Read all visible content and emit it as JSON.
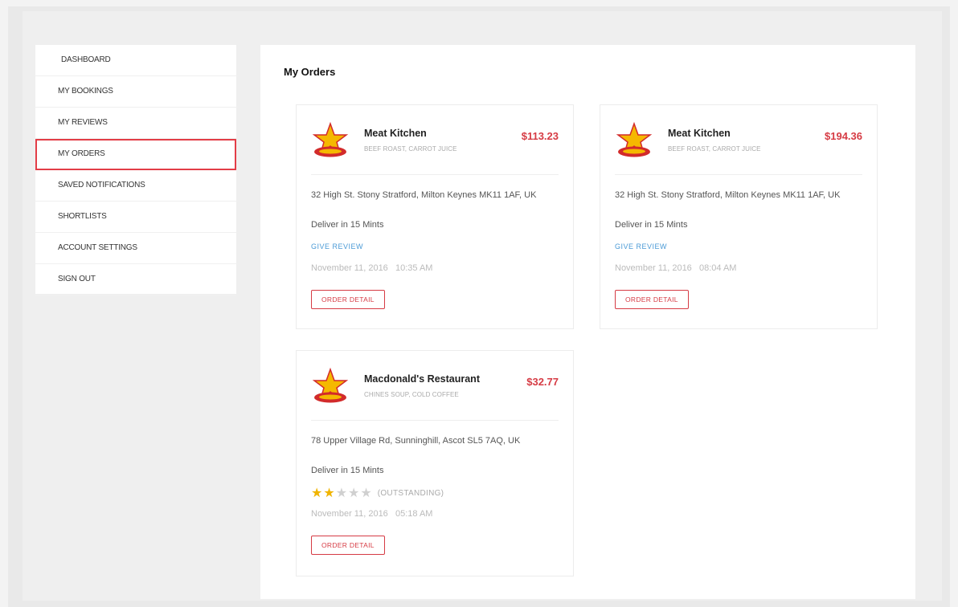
{
  "sidebar": {
    "items": [
      {
        "label": "DASHBOARD"
      },
      {
        "label": "MY BOOKINGS"
      },
      {
        "label": "MY REVIEWS"
      },
      {
        "label": "MY ORDERS"
      },
      {
        "label": "SAVED NOTIFICATIONS"
      },
      {
        "label": "SHORTLISTS"
      },
      {
        "label": "ACCOUNT SETTINGS"
      },
      {
        "label": "SIGN OUT"
      }
    ],
    "active_item": "MY ORDERS",
    "active_color": "#e33d47"
  },
  "main": {
    "title": "My Orders",
    "orders": [
      {
        "restaurant": "Meat Kitchen",
        "items": "BEEF ROAST, CARROT JUICE",
        "price": "$113.23",
        "address": "32 High St. Stony Stratford, Milton Keynes MK11 1AF, UK",
        "deliver": "Deliver in 15 Mints",
        "review_link": "GIVE REVIEW",
        "date": "November 11, 2016",
        "time": "10:35 AM",
        "detail_button": "ORDER DETAIL",
        "logo_icon": "star-burger-logo-icon"
      },
      {
        "restaurant": "Meat Kitchen",
        "items": "BEEF ROAST, CARROT JUICE",
        "price": "$194.36",
        "address": "32 High St. Stony Stratford, Milton Keynes MK11 1AF, UK",
        "deliver": "Deliver in 15 Mints",
        "review_link": "GIVE REVIEW",
        "date": "November 11, 2016",
        "time": "08:04 AM",
        "detail_button": "ORDER DETAIL",
        "logo_icon": "star-burger-logo-icon"
      },
      {
        "restaurant": "Macdonald's Restaurant",
        "items": "CHINES SOUP, COLD COFFEE",
        "price": "$32.77",
        "address": "78 Upper Village Rd, Sunninghill, Ascot SL5 7AQ, UK",
        "deliver": "Deliver in 15 Mints",
        "rating": 2,
        "rating_max": 5,
        "rating_label": "(OUTSTANDING)",
        "date": "November 11, 2016",
        "time": "05:18 AM",
        "detail_button": "ORDER DETAIL",
        "logo_icon": "star-burger-logo-icon"
      }
    ]
  },
  "colors": {
    "accent": "#d63b44",
    "link": "#4a9ad6",
    "star_on": "#f0b400",
    "star_off": "#d0d0d0"
  }
}
